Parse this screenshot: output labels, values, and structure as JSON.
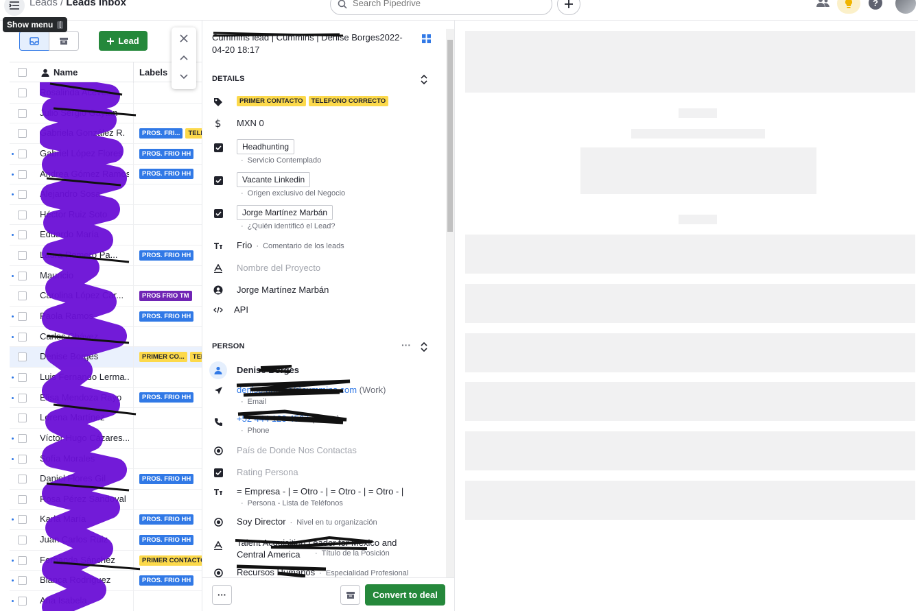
{
  "topbar": {
    "breadcrumb_parent": "Leads",
    "breadcrumb_sep": "/",
    "breadcrumb_current": "Leads Inbox",
    "search_placeholder": "Search Pipedrive"
  },
  "tooltip": {
    "label": "Show menu",
    "shortcut": "["
  },
  "toolbar": {
    "add_lead_label": "Lead"
  },
  "list": {
    "col_name": "Name",
    "col_labels": "Labels",
    "rows": [
      {
        "name": "Rosalinda Aceves",
        "dot": false,
        "tags": []
      },
      {
        "name": "Julio Sergio Gaytan",
        "dot": false,
        "tags": []
      },
      {
        "name": "Gabriela González R.",
        "dot": false,
        "tags": [
          {
            "t": "PROS. FRI...",
            "c": "blue"
          },
          {
            "t": "TELEF...",
            "c": "yellow"
          }
        ]
      },
      {
        "name": "Gabriel López Flores",
        "dot": true,
        "tags": [
          {
            "t": "PROS. FRIO HH",
            "c": "blue"
          }
        ]
      },
      {
        "name": "Andrea Gómez Ramos",
        "dot": true,
        "tags": [
          {
            "t": "PROS. FRIO HH",
            "c": "blue"
          }
        ]
      },
      {
        "name": "Alejandro Sosa",
        "dot": true,
        "tags": []
      },
      {
        "name": "Héctor Ruiz Soto",
        "dot": false,
        "tags": []
      },
      {
        "name": "Eduardo María",
        "dot": true,
        "tags": []
      },
      {
        "name": "Laura Romero Pa...",
        "dot": false,
        "tags": [
          {
            "t": "PROS. FRIO HH",
            "c": "blue"
          }
        ]
      },
      {
        "name": "Mauricio",
        "dot": true,
        "tags": []
      },
      {
        "name": "Carolina López Car...",
        "dot": false,
        "tags": [
          {
            "t": "PROS FRIO TM",
            "c": "purple"
          }
        ]
      },
      {
        "name": "Paola Ramos",
        "dot": true,
        "tags": [
          {
            "t": "PROS. FRIO HH",
            "c": "blue"
          }
        ]
      },
      {
        "name": "Carlos Chávez",
        "dot": true,
        "tags": []
      },
      {
        "name": "Denise Borges",
        "dot": false,
        "sel": true,
        "tags": [
          {
            "t": "PRIMER CO...",
            "c": "yellow"
          },
          {
            "t": "TELEF...",
            "c": "yellow"
          }
        ]
      },
      {
        "name": "Luis Fernando Lerma...",
        "dot": true,
        "tags": []
      },
      {
        "name": "Elisa Mendoza Rayo",
        "dot": true,
        "tags": [
          {
            "t": "PROS. FRIO HH",
            "c": "blue"
          }
        ]
      },
      {
        "name": "Lorena Martínez",
        "dot": false,
        "tags": []
      },
      {
        "name": "Víctor Hugo Cázares...",
        "dot": true,
        "tags": []
      },
      {
        "name": "Sofía Morales",
        "dot": true,
        "tags": []
      },
      {
        "name": "Daniel Flores Gil",
        "dot": false,
        "tags": [
          {
            "t": "PROS. FRIO HH",
            "c": "blue"
          }
        ]
      },
      {
        "name": "Rosa Pérez Sandoval",
        "dot": false,
        "tags": []
      },
      {
        "name": "Karla María",
        "dot": true,
        "tags": [
          {
            "t": "PROS. FRIO HH",
            "c": "blue"
          }
        ]
      },
      {
        "name": "Juan Carlos Ruiz",
        "dot": false,
        "tags": [
          {
            "t": "PROS. FRIO HH",
            "c": "blue"
          }
        ]
      },
      {
        "name": "Fernanda Sánchez",
        "dot": true,
        "tags": [
          {
            "t": "PRIMER CONTACTO",
            "c": "yellow"
          }
        ]
      },
      {
        "name": "Blanca Rodríguez",
        "dot": true,
        "tags": [
          {
            "t": "PROS. FRIO HH",
            "c": "blue"
          }
        ]
      },
      {
        "name": "Ana Isabela",
        "dot": true,
        "tags": []
      }
    ]
  },
  "detail": {
    "title": "Cummins lead | Cummins | Denise Borges2022-04-20 18:17",
    "details_header": "DETAILS",
    "tag1": "PRIMER CONTACTO",
    "tag2": "TELEFONO CORRECTO",
    "value": "MXN 0",
    "f1_value": "Headhunting",
    "f1_label": "Servicio Contemplado",
    "f2_value": "Vacante Linkedin",
    "f2_label": "Origen exclusivo del Negocio",
    "f3_value": "Jorge Martínez Marbán",
    "f3_label": "¿Quién identificó el Lead?",
    "comment_value": "Frio",
    "comment_label": "Comentario de los leads",
    "project_placeholder": "Nombre del Proyecto",
    "owner": "Jorge Martínez Marbán",
    "source": "API",
    "person_header": "PERSON",
    "person_name": "Denise Borges",
    "email": "denise.borges@cummins.com",
    "email_type": "(Work)",
    "email_label": "Email",
    "phone": "+52 444 123 4567",
    "phone_type": "(Other)",
    "phone_label": "Phone",
    "country_placeholder": "País de Donde Nos Contactas",
    "rating_placeholder": "Rating Persona",
    "phones_list_value": "= Empresa - | = Otro - | = Otro - | = Otro - |",
    "phones_list_label": "Persona - Lista de Teléfonos",
    "level_value": "Soy Director",
    "level_label": "Nivel en tu organización",
    "position_value": "Talent Acquisition Leader for Mexico and Central America",
    "position_label": "Título de la Posición",
    "specialty_value": "Recursos Humanos",
    "specialty_label": "Especialidad Profesional",
    "more_label": "···",
    "convert_label": "Convert to deal"
  },
  "colors": {
    "accent": "#3179e6",
    "green": "#25883b",
    "yellow_tag": "#fcd94b",
    "purple_tag": "#7024b5",
    "redaction": "#6a0fd6"
  }
}
